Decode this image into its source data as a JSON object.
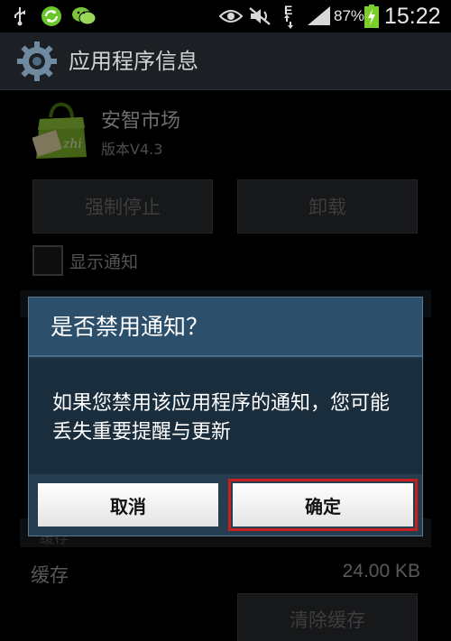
{
  "status_bar": {
    "battery_percent": "87%",
    "time": "15:22",
    "network_type": "E",
    "icons": [
      "usb-icon",
      "sync-icon",
      "wechat-icon",
      "eye-icon",
      "mute-icon",
      "data-arrows-icon",
      "signal-icon",
      "battery-charging-icon"
    ]
  },
  "action_bar": {
    "title": "应用程序信息",
    "icon": "gear-icon"
  },
  "app": {
    "name": "安智市场",
    "version": "版本V4.3",
    "icon": "shopping-bag-icon"
  },
  "buttons": {
    "force_stop": "强制停止",
    "uninstall": "卸载",
    "clear_cache": "清除缓存"
  },
  "notification_toggle": {
    "label": "显示通知",
    "checked": false
  },
  "storage": {
    "section_label": "缓存",
    "cache_label": "缓存",
    "cache_value": "24.00 KB"
  },
  "dialog": {
    "title": "是否禁用通知？",
    "message": "如果您禁用该应用程序的通知，您可能丢失重要提醒与更新",
    "cancel_label": "取消",
    "ok_label": "确定",
    "highlight_color": "#c8201e"
  }
}
